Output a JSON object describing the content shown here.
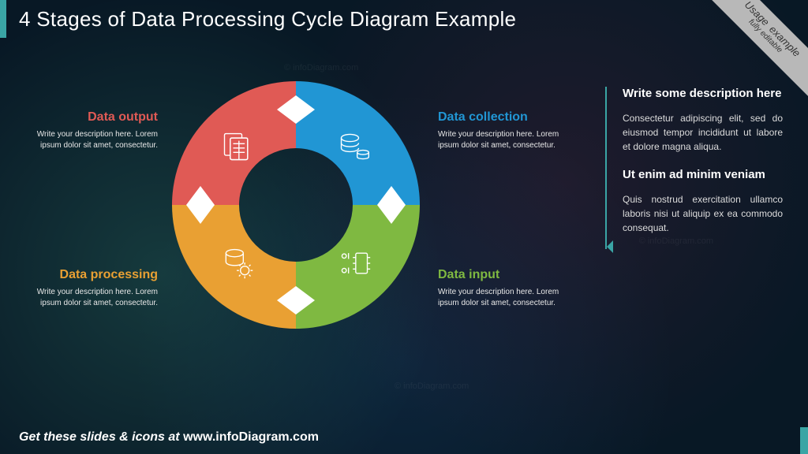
{
  "title": "4 Stages of Data Processing Cycle Diagram Example",
  "ribbon": {
    "line1": "Usage",
    "line2": "example",
    "line3": "fully editable"
  },
  "stages": {
    "collection": {
      "heading": "Data collection",
      "body": "Write your description here. Lorem ipsum dolor sit amet, consectetur.",
      "color": "#2196d4",
      "icon": "database-coins-icon"
    },
    "input": {
      "heading": "Data input",
      "body": "Write your description here. Lorem ipsum dolor sit amet, consectetur.",
      "color": "#7fb941",
      "icon": "chip-binary-icon"
    },
    "processing": {
      "heading": "Data processing",
      "body": "Write your description here. Lorem ipsum dolor sit amet, consectetur.",
      "color": "#e9a033",
      "icon": "database-gears-icon"
    },
    "output": {
      "heading": "Data output",
      "body": "Write your description here. Lorem ipsum dolor sit amet, consectetur.",
      "color": "#e05a55",
      "icon": "documents-table-icon"
    }
  },
  "sidebar": {
    "h1": "Write some description here",
    "p1": "Consectetur adipiscing elit, sed do eiusmod tempor incididunt ut labore et dolore magna aliqua.",
    "h2": "Ut enim ad minim veniam",
    "p2": "Quis nostrud exercitation ullamco laboris nisi ut aliquip ex ea commodo consequat."
  },
  "footer": {
    "prefix": "Get these slides & icons at ",
    "brand": "www.infoDiagram.com"
  },
  "watermark": "© infoDiagram.com"
}
